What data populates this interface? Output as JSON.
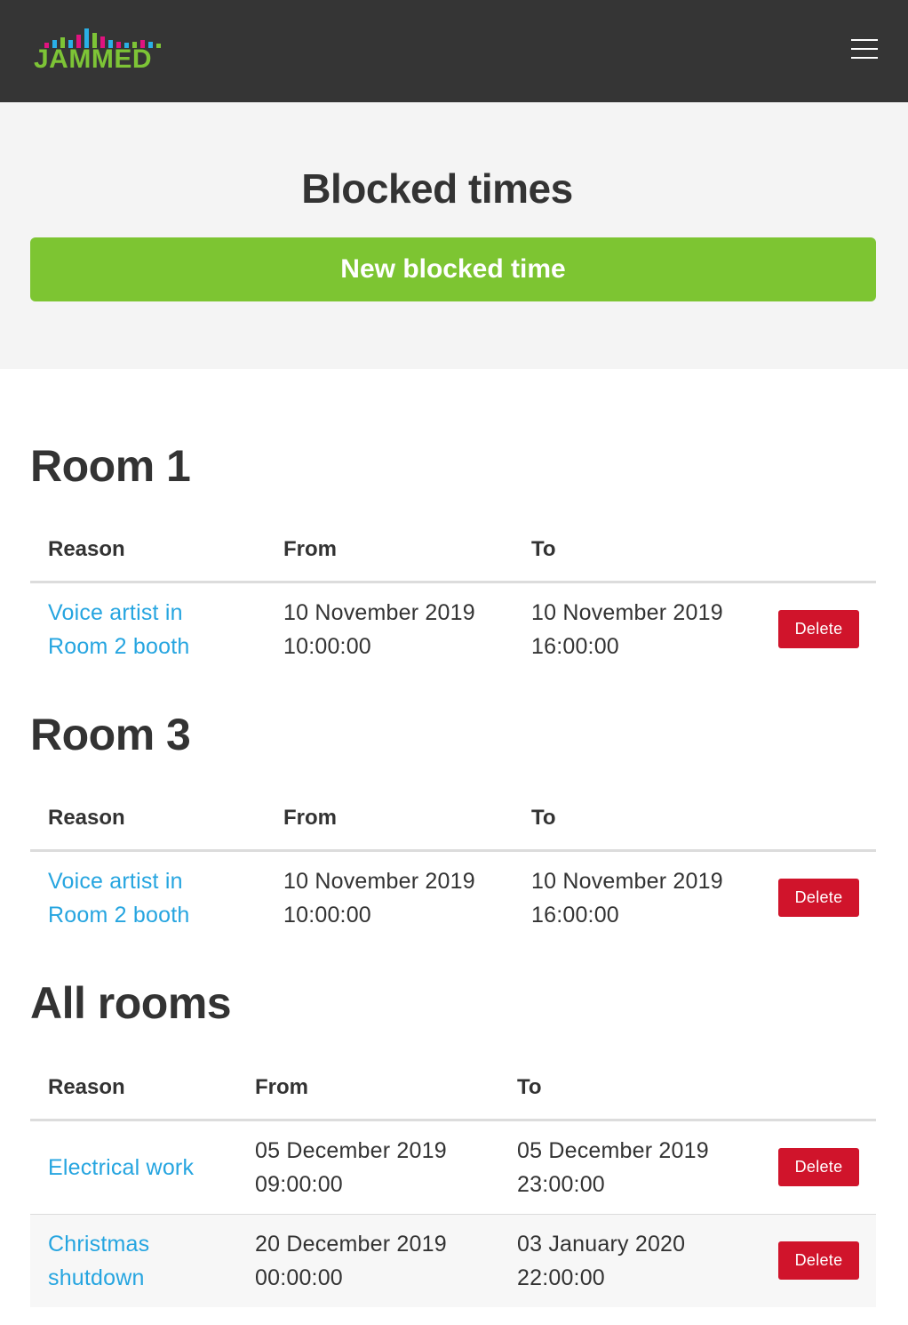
{
  "brand": {
    "name": "JAMMED",
    "text_color": "#7dc436",
    "bar_colors": [
      "#2ab0e6",
      "#7dc436",
      "#e0137f",
      "#f5a623"
    ]
  },
  "colors": {
    "navbar": "#353535",
    "primary_button": "#7dc532",
    "link": "#26a5e0",
    "delete": "#d0142b"
  },
  "page": {
    "title": "Blocked times",
    "new_button_label": "New blocked time"
  },
  "sections": [
    {
      "title": "Room 1",
      "headers": {
        "reason": "Reason",
        "from": "From",
        "to": "To"
      },
      "rows": [
        {
          "reason_line1": "Voice artist in",
          "reason_line2": "Room 2 booth",
          "from_date": "10 November 2019",
          "from_time": "10:00:00",
          "to_date": "10 November 2019",
          "to_time": "16:00:00",
          "action": "Delete"
        }
      ]
    },
    {
      "title": "Room 3",
      "headers": {
        "reason": "Reason",
        "from": "From",
        "to": "To"
      },
      "rows": [
        {
          "reason_line1": "Voice artist in",
          "reason_line2": "Room 2 booth",
          "from_date": "10 November 2019",
          "from_time": "10:00:00",
          "to_date": "10 November 2019",
          "to_time": "16:00:00",
          "action": "Delete"
        }
      ]
    },
    {
      "title": "All rooms",
      "headers": {
        "reason": "Reason",
        "from": "From",
        "to": "To"
      },
      "rows": [
        {
          "reason_line1": "Electrical work",
          "reason_line2": "",
          "from_date": "05 December 2019",
          "from_time": "09:00:00",
          "to_date": "05 December 2019",
          "to_time": "23:00:00",
          "action": "Delete"
        },
        {
          "reason_line1": "Christmas",
          "reason_line2": "shutdown",
          "from_date": "20 December 2019",
          "from_time": "00:00:00",
          "to_date": "03 January 2020",
          "to_time": "22:00:00",
          "action": "Delete"
        }
      ]
    }
  ]
}
